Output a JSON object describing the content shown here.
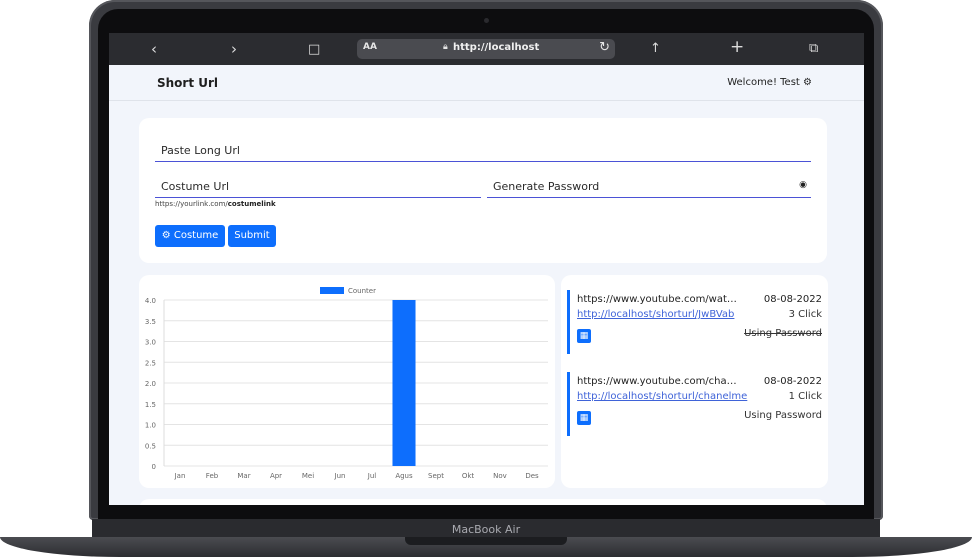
{
  "device": {
    "label": "MacBook Air"
  },
  "browser": {
    "url": "http://localhost",
    "text_size_label": "AA",
    "icons": [
      "chevron-left-icon",
      "chevron-right-icon",
      "book-icon",
      "lock-icon",
      "reload-icon",
      "share-icon",
      "plus-icon",
      "tabs-icon"
    ]
  },
  "navbar": {
    "brand": "Short Url",
    "welcome": "Welcome! Test"
  },
  "form": {
    "long_url_placeholder": "Paste Long Url",
    "custom_url_placeholder": "Costume Url",
    "password_placeholder": "Generate Password",
    "hint_prefix": "https://yourlink.com/",
    "hint_suffix": "costumelink",
    "custom_button": "Costume",
    "submit_button": "Submit"
  },
  "colors": {
    "primary": "#0d6efd",
    "link": "#3f63d8",
    "background": "#f2f5fb"
  },
  "chart_data": {
    "type": "bar",
    "categories": [
      "Jan",
      "Feb",
      "Mar",
      "Apr",
      "Mei",
      "Jun",
      "Jul",
      "Agus",
      "Sept",
      "Okt",
      "Nov",
      "Des"
    ],
    "series": [
      {
        "name": "Counter",
        "values": [
          0,
          0,
          0,
          0,
          0,
          0,
          0,
          4,
          0,
          0,
          0,
          0
        ]
      }
    ],
    "ylim": [
      0,
      4
    ],
    "yticks": [
      "0",
      "0.5",
      "1.0",
      "1.5",
      "2.0",
      "2.5",
      "3.0",
      "3.5",
      "4.0"
    ],
    "legend": "top-center",
    "grid": true
  },
  "links": [
    {
      "long_url": "https://www.youtube.com/watc...",
      "date": "08-08-2022",
      "short_url": "http://localhost/shorturl/JwBVab",
      "clicks": "3 Click",
      "password": "Using Password",
      "password_active": false
    },
    {
      "long_url": "https://www.youtube.com/chan...",
      "date": "08-08-2022",
      "short_url": "http://localhost/shorturl/chanelme",
      "clicks": "1 Click",
      "password": "Using Password",
      "password_active": true
    }
  ]
}
